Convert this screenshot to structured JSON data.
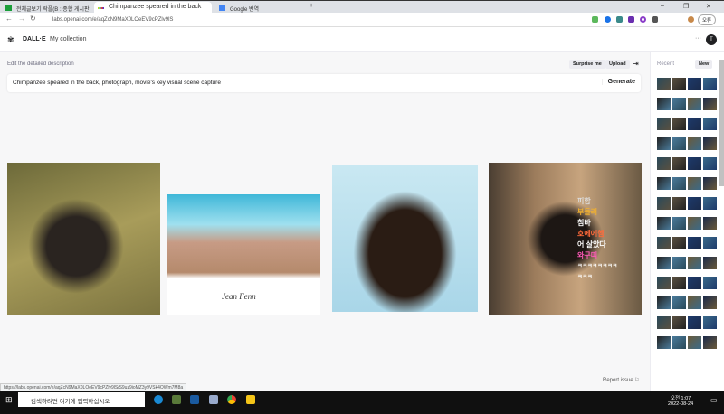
{
  "browser": {
    "tabs": [
      {
        "title": "전체글보기 락플(B : 종합 게시판"
      },
      {
        "title": "Chimpanzee speared in the back"
      },
      {
        "title": "Google 번역"
      }
    ],
    "url": "labs.openai.com/e/aqZcN9MaX0LOeEV9cPZlv9lS",
    "profile_label": "오류"
  },
  "app": {
    "brand": "DALL·E",
    "nav_collection": "My collection",
    "avatar": "T",
    "more": "···"
  },
  "editor": {
    "label": "Edit the detailed description",
    "surprise": "Surprise me",
    "upload": "Upload",
    "prompt": "Chimpanzee speared in the back, photograph, movie's key visual scene capture",
    "generate": "Generate",
    "report": "Report issue"
  },
  "overlay_text": [
    "피함",
    "부들러",
    "침바",
    "호에에헴",
    "어 살았다",
    "와구띠",
    "ㅋㅋㅋㅋㅋㅋㅋㅋ",
    "ㅋㅋㅋ"
  ],
  "sidebar": {
    "title": "Recent",
    "new": "New"
  },
  "image4_caption": "Jean Fenn",
  "status_url": "https://labs.openai.com/e/aqZcN9MaX0LOeEV9cPZlv9lS/S9uz9ioMZ3y9VSk4OWm7M8a",
  "taskbar": {
    "search": "검색하려면 여기에 입력하십시오",
    "time": "오전 1:07",
    "date": "2022-08-24"
  }
}
